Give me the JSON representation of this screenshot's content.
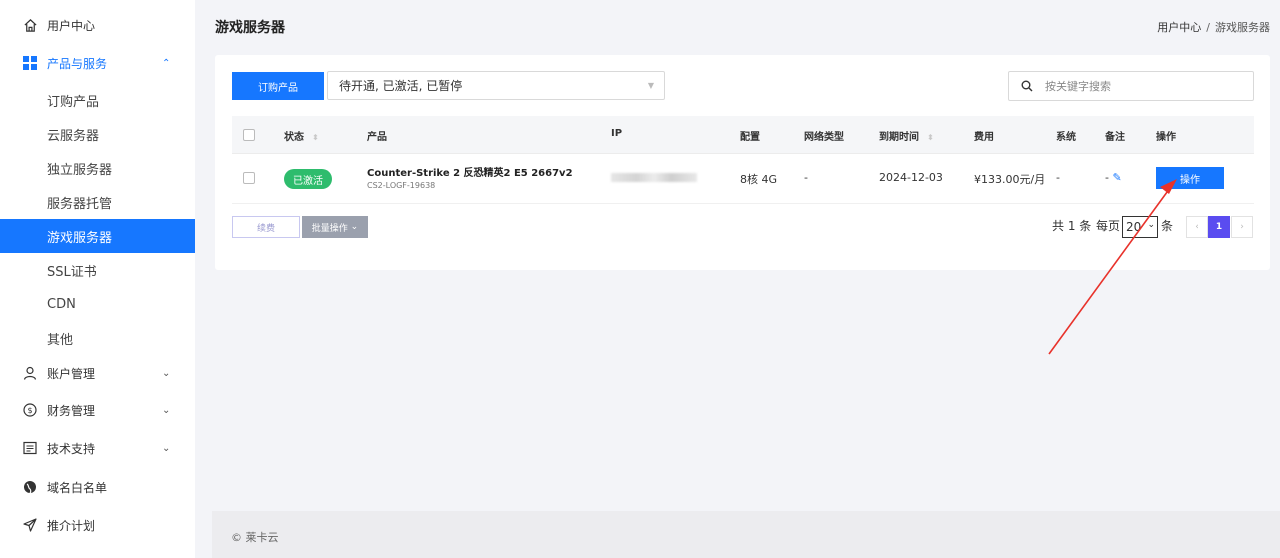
{
  "sidebar": {
    "items": [
      {
        "label": "用户中心",
        "icon": "home-icon"
      },
      {
        "label": "产品与服务",
        "icon": "grid-icon"
      },
      {
        "label": "订购产品"
      },
      {
        "label": "云服务器"
      },
      {
        "label": "独立服务器"
      },
      {
        "label": "服务器托管"
      },
      {
        "label": "游戏服务器"
      },
      {
        "label": "SSL证书"
      },
      {
        "label": "CDN"
      },
      {
        "label": "其他"
      },
      {
        "label": "账户管理",
        "icon": "user-icon"
      },
      {
        "label": "财务管理",
        "icon": "dollar-icon"
      },
      {
        "label": "技术支持",
        "icon": "ticket-icon"
      },
      {
        "label": "域名白名单",
        "icon": "globe-icon"
      },
      {
        "label": "推介计划",
        "icon": "send-icon"
      }
    ]
  },
  "header": {
    "title": "游戏服务器",
    "breadcrumb": [
      "用户中心",
      "/",
      "游戏服务器"
    ]
  },
  "toolbar": {
    "order_label": "订购产品",
    "status_filter": "待开通, 已激活, 已暂停",
    "search_placeholder": "按关键字搜索"
  },
  "table": {
    "columns": [
      "状态",
      "产品",
      "IP",
      "配置",
      "网络类型",
      "到期时间",
      "费用",
      "系统",
      "备注",
      "操作"
    ],
    "rows": [
      {
        "status": "已激活",
        "product": "Counter-Strike 2 反恐精英2 E5 2667v2",
        "code": "CS2-LOGF-19638",
        "config": "8核 4G",
        "network": "-",
        "expire": "2024-12-03",
        "fee": "¥133.00元/月",
        "os": "-",
        "note": "-",
        "action": "操作"
      }
    ]
  },
  "bottom": {
    "renew": "续费",
    "bulk": "批量操作",
    "total": "共 1 条",
    "per_page": "每页",
    "page_size": "20",
    "unit": "条",
    "current_page": "1"
  },
  "footer": {
    "text": "© 莱卡云"
  },
  "colors": {
    "accent": "#1677ff",
    "active_badge": "#2ebc6d",
    "arrow": "#e8322b"
  }
}
